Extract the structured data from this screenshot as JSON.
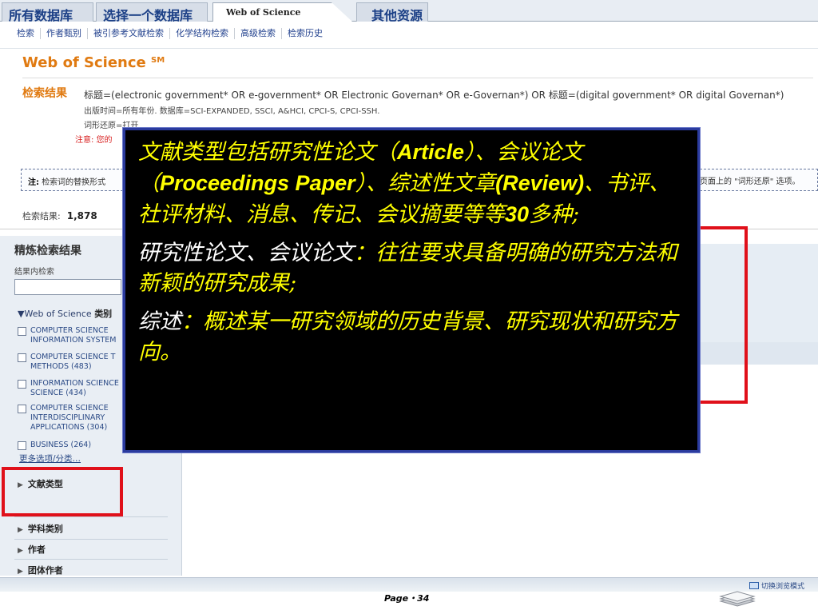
{
  "top_tabs": [
    "所有数据库",
    "选择一个数据库",
    "Web of Science",
    "其他资源"
  ],
  "sub_nav": [
    "检索",
    "作者甄别",
    "被引参考文献检索",
    "化学结构检索",
    "高级检索",
    "检索历史"
  ],
  "header": {
    "brand": "Web of Science",
    "brand_sup": "SM"
  },
  "results": {
    "label": "检索结果",
    "query_line1": "标题=(electronic government* OR e-government* OR Electronic Governan* OR e-Governan*) OR 标题=(digital government* OR digital Governan*)",
    "query_line2": "出版时间=所有年份. 数据库=SCI-EXPANDED, SSCI, A&HCI, CPCI-S, CPCI-SSH.",
    "query_line3": "词形还原=打开",
    "note": "注意: 您的",
    "tip_left_bold": "注:",
    "tip_left": "检索词的替换形式",
    "tip_right": "页面上的 \"词形还原\" 选项。",
    "count_label": "检索结果:",
    "count_value": "1,878"
  },
  "refine": {
    "title": "精炼检索结果",
    "within_label": "结果内检索",
    "section_label": "Web of Science",
    "section_bold": "类别",
    "categories": [
      "COMPUTER SCIENCE INFORMATION SYSTEM",
      "COMPUTER SCIENCE T METHODS (483)",
      "INFORMATION SCIENCE SCIENCE (434)",
      "COMPUTER SCIENCE INTERDISCIPLINARY APPLICATIONS (304)",
      "BUSINESS (264)"
    ],
    "more_link": "更多选项/分类…",
    "facets": [
      "文献类型",
      "学科类别",
      "作者",
      "团体作者"
    ]
  },
  "footer": {
    "switch_view": "切换浏览模式",
    "page": "Page・34"
  },
  "overlay": {
    "p1_a": "文献类型包括研究性论文（",
    "p1_b": "Article",
    "p1_c": "）、会议论文（",
    "p1_d": "Proceedings Paper",
    "p1_e": "）、综述性文章",
    "p1_f": "(Review)",
    "p1_g": "、书评、社评材料、消息、传记、会议摘要等等",
    "p1_h": "30",
    "p1_i": "多种;",
    "p2_a": "研究性论文、会议论文",
    "p2_b": "：往往要求具备明确的研究方法和新颖的研究成果;",
    "p3_a": "综述",
    "p3_b": "：概述某一研究领域的历史背景、研究现状和研究方向。"
  },
  "colors": {
    "brand_orange": "#e07a11",
    "highlight_red": "#e0101a",
    "overlay_text": "#ffff00",
    "overlay_bg": "#000000"
  }
}
